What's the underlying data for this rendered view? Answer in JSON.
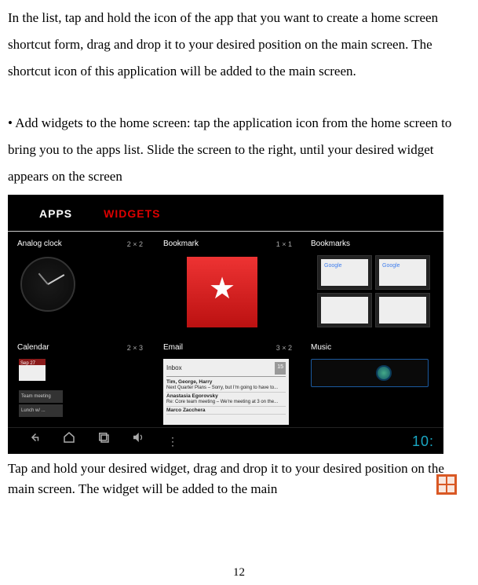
{
  "para1": "In the list, tap and hold the icon of the app that you want to create a home screen shortcut form, drag and drop it to your desired position on the main screen. The shortcut icon of this application will be added to the main screen.",
  "para2_pre": "• Add widgets to the home screen: tap the application icon   from the home screen to bring you to the apps list. Slide the screen to the right, until your desired widget appears on the screen",
  "tabs": {
    "apps": "APPS",
    "widgets": "WIDGETS"
  },
  "row1": {
    "analog": {
      "label": "Analog clock",
      "dim": "2 × 2"
    },
    "bookmark": {
      "label": "Bookmark",
      "dim": "1 × 1"
    },
    "bookmarks": {
      "label": "Bookmarks"
    }
  },
  "row2": {
    "calendar": {
      "label": "Calendar",
      "dim": "2 × 3",
      "date": "Sep 27"
    },
    "email": {
      "label": "Email",
      "dim": "3 × 2",
      "inbox": "Inbox",
      "count": "15",
      "e1_from": "Tim, George, Harry",
      "e1_sub": "Next Quarter Plans – Sorry, but I'm going to have to...",
      "e2_from": "Anastasia Egorovsky",
      "e2_sub": "Re: Core team meeting – We're meeting at 3 on the...",
      "e3_from": "Marco Zacchera"
    },
    "music": {
      "label": "Music"
    }
  },
  "navtime": "10:",
  "para3": "Tap and hold your desired widget, drag and drop it to your desired position on the main screen. The widget will be added to the main",
  "pagenum": "12"
}
